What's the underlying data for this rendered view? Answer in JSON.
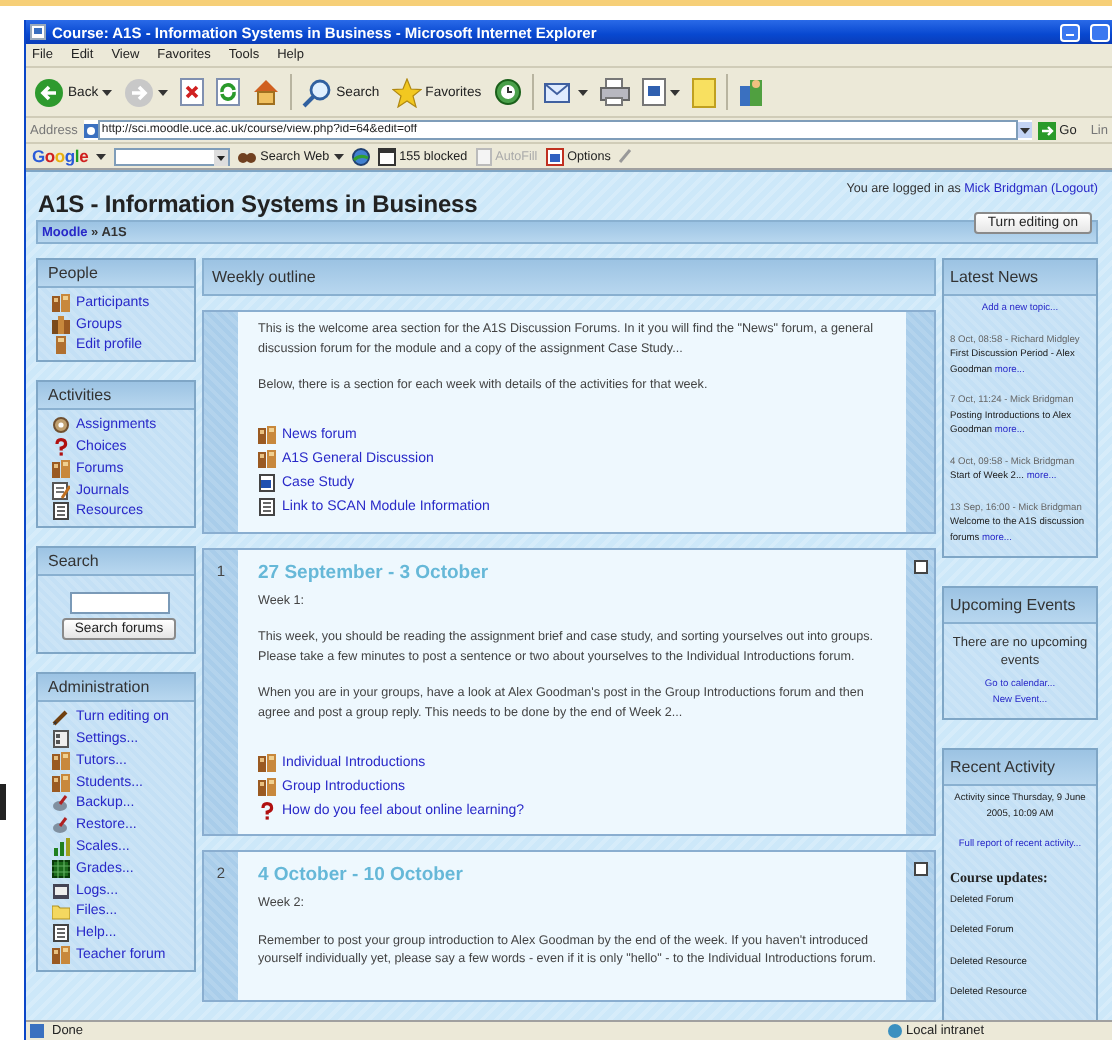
{
  "window": {
    "title": "Course: A1S - Information Systems in Business - Microsoft Internet Explorer"
  },
  "menu": [
    "File",
    "Edit",
    "View",
    "Favorites",
    "Tools",
    "Help"
  ],
  "toolbar": [
    {
      "kind": "back",
      "label": "Back"
    },
    {
      "kind": "forward"
    },
    {
      "kind": "stop"
    },
    {
      "kind": "refresh"
    },
    {
      "kind": "home"
    },
    {
      "kind": "search",
      "label": "Search"
    },
    {
      "kind": "favorites",
      "label": "Favorites"
    },
    {
      "kind": "history"
    },
    {
      "kind": "mail"
    },
    {
      "kind": "print"
    },
    {
      "kind": "edit"
    },
    {
      "kind": "notes"
    },
    {
      "kind": "messenger"
    }
  ],
  "address": {
    "label": "Address",
    "value": "http://sci.moodle.uce.ac.uk/course/view.php?id=64&edit=off",
    "go": "Go",
    "links": "Lin"
  },
  "google_bar": {
    "logo": "Google",
    "search": "Search Web",
    "blocked": "155 blocked",
    "autofill": "AutoFill",
    "options": "Options"
  },
  "course": {
    "title": "A1S - Information Systems in Business",
    "login_prefix": "You are logged in as",
    "user": "Mick Bridgman",
    "logout": "(Logout)",
    "breadcrumb_home": "Moodle",
    "breadcrumb_separator": "»",
    "breadcrumb_current": "A1S",
    "edit_button": "Turn editing on"
  },
  "left_blocks": [
    {
      "kind": "links",
      "title": "People",
      "items": [
        {
          "kind": "forum",
          "label": "Participants"
        },
        {
          "kind": "groups",
          "label": "Groups"
        },
        {
          "kind": "profile",
          "label": "Edit profile"
        }
      ]
    },
    {
      "kind": "links",
      "title": "Activities",
      "items": [
        {
          "kind": "assignment",
          "label": "Assignments"
        },
        {
          "kind": "choice",
          "label": "Choices"
        },
        {
          "kind": "forum",
          "label": "Forums"
        },
        {
          "kind": "journal",
          "label": "Journals"
        },
        {
          "kind": "resource",
          "label": "Resources"
        }
      ]
    },
    {
      "kind": "search",
      "title": "Search",
      "button": "Search forums"
    },
    {
      "kind": "links",
      "title": "Administration",
      "items": [
        {
          "kind": "edit",
          "label": "Turn editing on"
        },
        {
          "kind": "settings",
          "label": "Settings..."
        },
        {
          "kind": "forum",
          "label": "Tutors..."
        },
        {
          "kind": "forum",
          "label": "Students..."
        },
        {
          "kind": "backup",
          "label": "Backup..."
        },
        {
          "kind": "backup",
          "label": "Restore..."
        },
        {
          "kind": "scales",
          "label": "Scales..."
        },
        {
          "kind": "grades",
          "label": "Grades..."
        },
        {
          "kind": "logs",
          "label": "Logs..."
        },
        {
          "kind": "files",
          "label": "Files..."
        },
        {
          "kind": "resource",
          "label": "Help..."
        },
        {
          "kind": "forum",
          "label": "Teacher forum"
        }
      ]
    }
  ],
  "outline": {
    "title": "Weekly outline",
    "sections": [
      {
        "paragraphs": [
          "This is the welcome area section for the A1S Discussion Forums. In it you will find the \"News\" forum, a general discussion forum for the module and a copy of the assignment Case Study...",
          "Below, there is a section for each week with details of the activities for that week."
        ],
        "links": [
          {
            "kind": "forum",
            "label": "News forum"
          },
          {
            "kind": "forum",
            "label": "A1S General Discussion"
          },
          {
            "kind": "word",
            "label": "Case Study"
          },
          {
            "kind": "resource",
            "label": "Link to SCAN Module Information"
          }
        ]
      },
      {
        "number": "1",
        "title": "27 September - 3 October",
        "paragraphs": [
          "Week 1:",
          "This week, you should be reading the assignment brief and case study,  and sorting yourselves out into groups. Please take a few minutes to post a sentence or two about yourselves to the Individual Introductions forum.",
          "When you are in your groups, have a look at Alex Goodman's post in the Group Introductions forum and then agree and post a group reply. This needs to be done by the end of Week 2..."
        ],
        "links": [
          {
            "kind": "forum",
            "label": "Individual Introductions"
          },
          {
            "kind": "forum",
            "label": "Group Introductions"
          },
          {
            "kind": "choice",
            "label": "How do you feel about online learning?"
          }
        ]
      },
      {
        "number": "2",
        "title": "4 October - 10 October",
        "paragraphs": [
          "Week 2:",
          "Remember to post your group introduction to Alex Goodman by the end of the week. If you haven't introduced yourself individually yet, please say a few words - even if it is only \"hello\" - to the Individual Introductions forum."
        ]
      }
    ]
  },
  "latest_news": {
    "title": "Latest News",
    "add": "Add a new topic...",
    "items": [
      {
        "meta": "8 Oct, 08:58 - Richard Midgley",
        "text": "First Discussion Period - Alex Goodman",
        "more": "more..."
      },
      {
        "meta": "7 Oct, 11:24 - Mick Bridgman",
        "text": "Posting Introductions to Alex Goodman",
        "more": "more..."
      },
      {
        "meta": "4 Oct, 09:58 - Mick Bridgman",
        "text": "Start of Week 2...",
        "more": "more..."
      },
      {
        "meta": "13 Sep, 16:00 - Mick Bridgman",
        "text": "Welcome to the A1S discussion forums",
        "more": "more..."
      }
    ]
  },
  "upcoming": {
    "title": "Upcoming Events",
    "text": "There are no upcoming events",
    "links": [
      "Go to calendar...",
      "New Event..."
    ]
  },
  "recent": {
    "title": "Recent Activity",
    "since": "Activity since Thursday, 9 June 2005, 10:09 AM",
    "report": "Full report of recent activity...",
    "updates_title": "Course updates:",
    "updates": [
      "Deleted Forum",
      "Deleted Forum",
      "Deleted Resource",
      "Deleted Resource"
    ]
  },
  "status_bar": {
    "text": "Done",
    "zone": "Local intranet"
  }
}
